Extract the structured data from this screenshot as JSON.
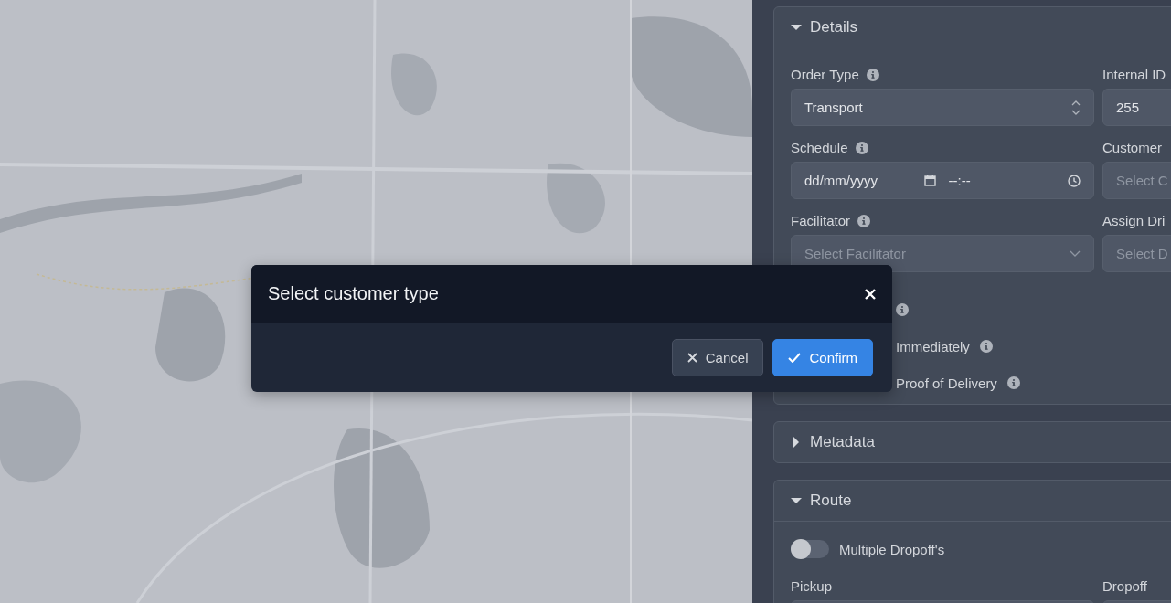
{
  "panel": {
    "sections": [
      {
        "title": "Details",
        "expanded": true,
        "fields": [
          {
            "label": "Order Type",
            "info": true,
            "kind": "select",
            "value": "Transport"
          },
          {
            "label": "Internal ID",
            "info": false,
            "kind": "text",
            "value": "255"
          },
          {
            "label": "Schedule",
            "info": true,
            "kind": "datetime",
            "placeholder": "dd/mm/yyyy",
            "time_placeholder": "--:--"
          },
          {
            "label": "Customer",
            "info": false,
            "kind": "partial",
            "placeholder": "Select C"
          },
          {
            "label": "Facilitator",
            "info": true,
            "kind": "dropdown",
            "placeholder": "Select Facilitator"
          },
          {
            "label": "Assign Dri",
            "info": false,
            "kind": "partial",
            "placeholder": "Select D"
          }
        ],
        "options": [
          {
            "info": true
          },
          {
            "label": "Immediately",
            "info": true
          },
          {
            "label": "Proof of Delivery",
            "info": true
          }
        ]
      },
      {
        "title": "Metadata",
        "expanded": false
      },
      {
        "title": "Route",
        "expanded": true,
        "toggles": [
          {
            "label": "Multiple Dropoff's",
            "on": false
          }
        ],
        "fields": [
          {
            "label": "Pickup",
            "info": false,
            "kind": "empty"
          },
          {
            "label": "Dropoff",
            "info": false,
            "kind": "empty"
          }
        ]
      }
    ]
  },
  "modal": {
    "title": "Select customer type",
    "buttons": [
      {
        "label": "Cancel",
        "kind": "cancel"
      },
      {
        "label": "Confirm",
        "kind": "confirm"
      }
    ]
  }
}
